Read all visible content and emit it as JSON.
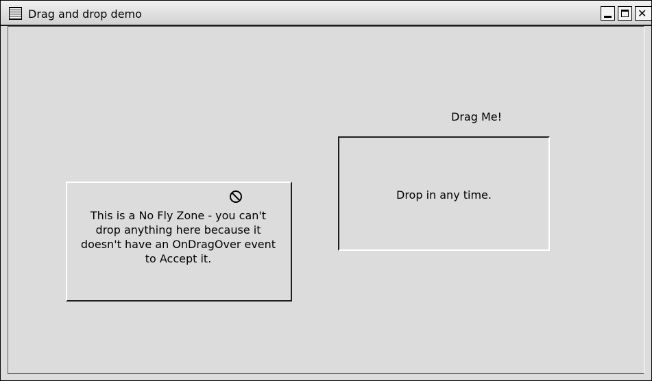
{
  "window": {
    "title": "Drag and drop demo",
    "buttons": {
      "minimize": "minimize",
      "maximize": "maximize",
      "close": "✕"
    }
  },
  "drag_source": {
    "label": "Drag Me!"
  },
  "drop_zone": {
    "text": "Drop in any time."
  },
  "no_fly_zone": {
    "lines": [
      "This is a No Fly Zone - you can't",
      "drop anything here because it",
      "doesn't have an OnDragOver event",
      "to Accept it."
    ],
    "icon": "no-drop-icon"
  }
}
